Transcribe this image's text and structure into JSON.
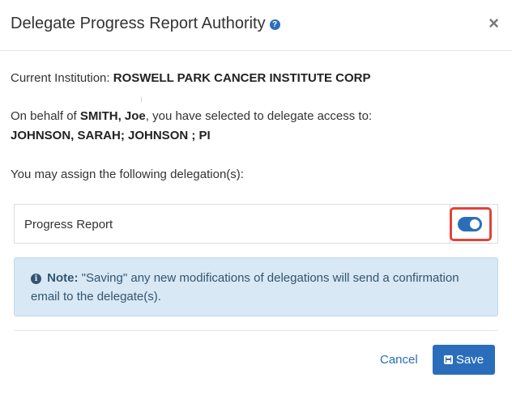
{
  "dialog": {
    "title": "Delegate Progress Report Authority",
    "help_icon": "question-circle-icon",
    "close_label": "×"
  },
  "institution": {
    "label": "Current Institution:",
    "name": "ROSWELL PARK CANCER INSTITUTE CORP"
  },
  "behalf": {
    "prefix": "On behalf of",
    "name": "SMITH,  Joe",
    "suffix": ",   you have selected to delegate access to:",
    "delegates": "JOHNSON, SARAH; JOHNSON ; PI"
  },
  "assign_text": "You may assign the following delegation(s):",
  "delegations": [
    {
      "label": "Progress Report",
      "enabled": true
    }
  ],
  "note": {
    "icon": "info-circle-icon",
    "label": "Note:",
    "text": "\"Saving\" any new modifications of delegations will send a confirmation email to the delegate(s)."
  },
  "footer": {
    "cancel_label": "Cancel",
    "save_label": "Save",
    "save_icon": "floppy-disk-icon"
  },
  "colors": {
    "primary": "#2a6ebb",
    "note_bg": "#d9e8f5",
    "highlight": "#e0443c"
  }
}
